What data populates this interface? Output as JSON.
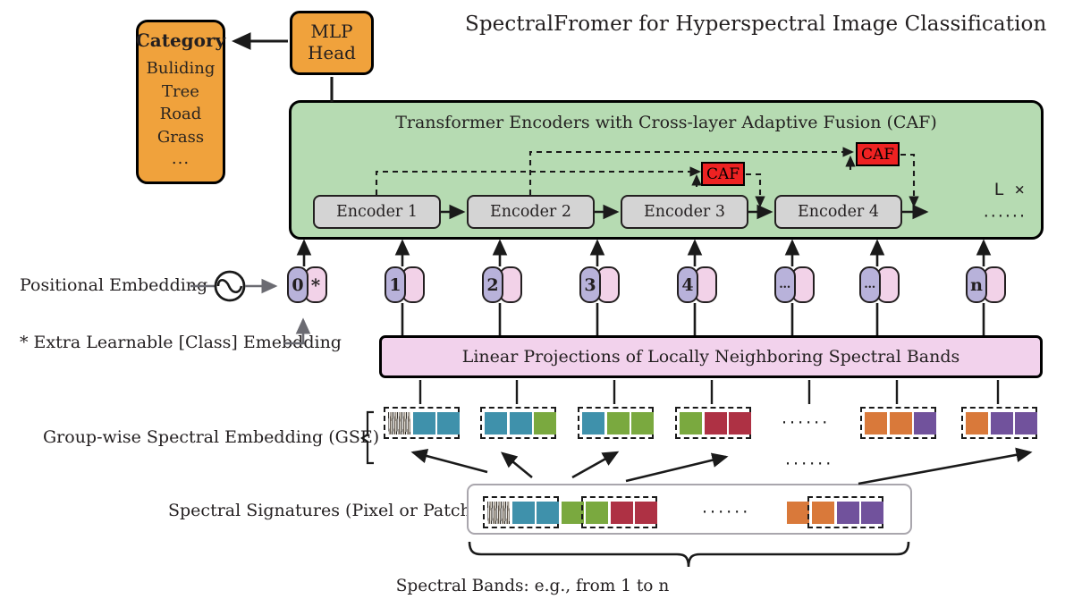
{
  "title": "SpectralFromer for Hyperspectral Image Classification",
  "category_box": {
    "heading": "Category",
    "items": [
      "Buliding",
      "Tree",
      "Road",
      "Grass"
    ],
    "ellipsis": "...",
    "color": "#f0a23c"
  },
  "mlp_head": {
    "line1": "MLP",
    "line2": "Head",
    "color": "#f0a23c"
  },
  "transformer_panel": {
    "caption": "Transformer Encoders with Cross-layer Adaptive Fusion (CAF)",
    "repeat_label": "L ×",
    "trailing_dots": "······",
    "color": "#b6dbb2",
    "encoders": [
      {
        "label": "Encoder 1"
      },
      {
        "label": "Encoder 2"
      },
      {
        "label": "Encoder 3"
      },
      {
        "label": "Encoder 4"
      }
    ],
    "caf_blocks": [
      {
        "label": "CAF"
      },
      {
        "label": "CAF"
      }
    ],
    "caf_color": "#ee2222",
    "encoder_color": "#d4d4d4"
  },
  "positional_embedding": {
    "label": "Positional Embedding",
    "icon": "sine-wave-circle-icon"
  },
  "class_embedding_note": {
    "label": "* Extra Learnable [Class] Emebdding"
  },
  "tokens": [
    {
      "num": "0",
      "pink": "*"
    },
    {
      "num": "1",
      "pink": ""
    },
    {
      "num": "2",
      "pink": ""
    },
    {
      "num": "3",
      "pink": ""
    },
    {
      "num": "4",
      "pink": ""
    },
    {
      "num": "…",
      "pink": ""
    },
    {
      "num": "…",
      "pink": ""
    },
    {
      "num": "n",
      "pink": ""
    }
  ],
  "token_colors": {
    "num": "#b8b2da",
    "pink": "#f2d2e8"
  },
  "linear_projection": {
    "label": "Linear Projections of Locally Neighboring Spectral Bands",
    "color": "#f2d2ec"
  },
  "gse": {
    "label": "Group-wise Spectral Embedding (GSE)",
    "ellipsis": "······",
    "groups": [
      {
        "patches": [
          "texture",
          "#3f91ab",
          "#3f91ab"
        ]
      },
      {
        "patches": [
          "#3f91ab",
          "#3f91ab",
          "#7aa93f"
        ]
      },
      {
        "patches": [
          "#3f91ab",
          "#7aa93f",
          "#7aa93f"
        ]
      },
      {
        "patches": [
          "#7aa93f",
          "#ae3144",
          "#ae3144"
        ]
      },
      {
        "patches": [
          "#d9793a",
          "#d9793a",
          "#71529c"
        ]
      },
      {
        "patches": [
          "#d9793a",
          "#71529c",
          "#71529c"
        ]
      }
    ]
  },
  "spectral_signatures": {
    "label": "Spectral Signatures (Pixel or Patch)",
    "ellipsis": "······",
    "patches_left": [
      "texture",
      "#3f91ab",
      "#3f91ab",
      "#7aa93f",
      "#7aa93f",
      "#ae3144",
      "#ae3144"
    ],
    "patches_right": [
      "#d9793a",
      "#d9793a",
      "#71529c",
      "#71529c"
    ]
  },
  "bottom_caption": "Spectral Bands: e.g., from 1 to n"
}
